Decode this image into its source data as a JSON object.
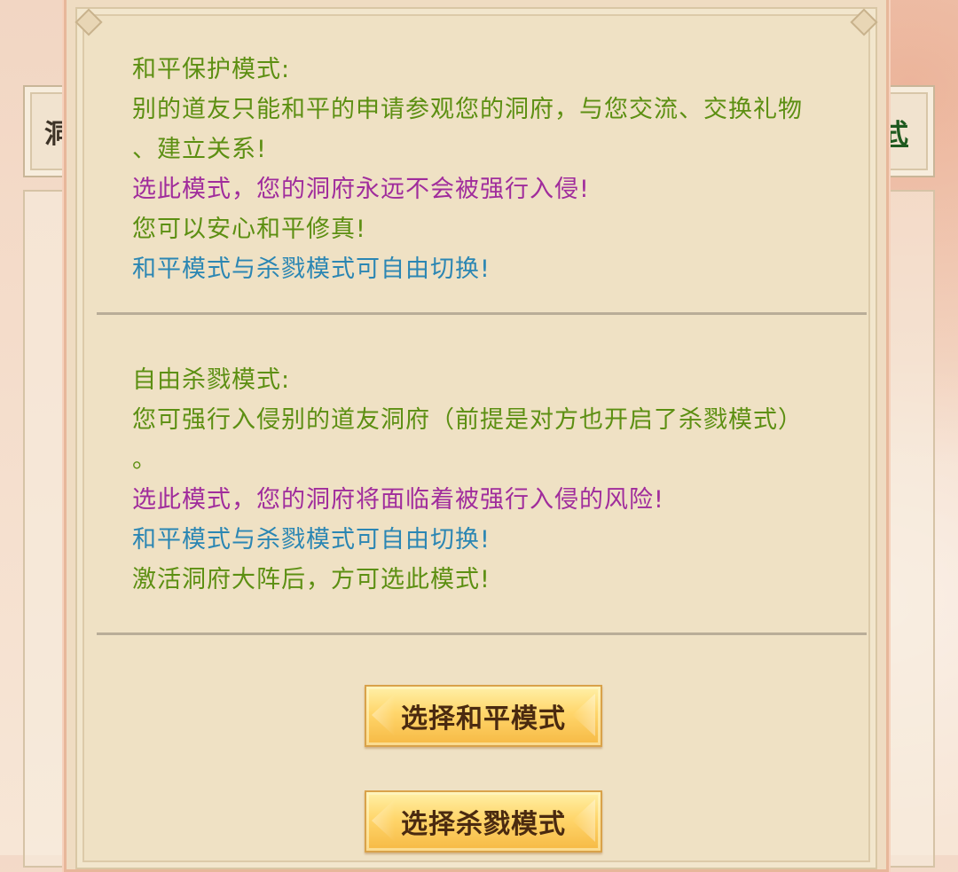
{
  "background": {
    "left_tab_label": "洞",
    "right_tab_label": "式"
  },
  "peace_section": {
    "lines": [
      "和平保护模式:",
      "别的道友只能和平的申请参观您的洞府，与您交流、交换礼物",
      "、建立关系!",
      "选此模式，您的洞府永远不会被强行入侵!",
      "您可以安心和平修真!",
      "和平模式与杀戮模式可自由切换!"
    ]
  },
  "kill_section": {
    "lines": [
      "自由杀戮模式:",
      "您可强行入侵别的道友洞府（前提是对方也开启了杀戮模式）",
      "。",
      "选此模式，您的洞府将面临着被强行入侵的风险!",
      "和平模式与杀戮模式可自由切换!",
      "激活洞府大阵后，方可选此模式!"
    ]
  },
  "buttons": {
    "peace_label": "选择和平模式",
    "kill_label": "选择杀戮模式"
  },
  "colors": {
    "text_green": "#5c8f12",
    "text_magenta": "#a02c9c",
    "text_blue": "#2b86b3",
    "button_gold": "#ffd66b"
  }
}
